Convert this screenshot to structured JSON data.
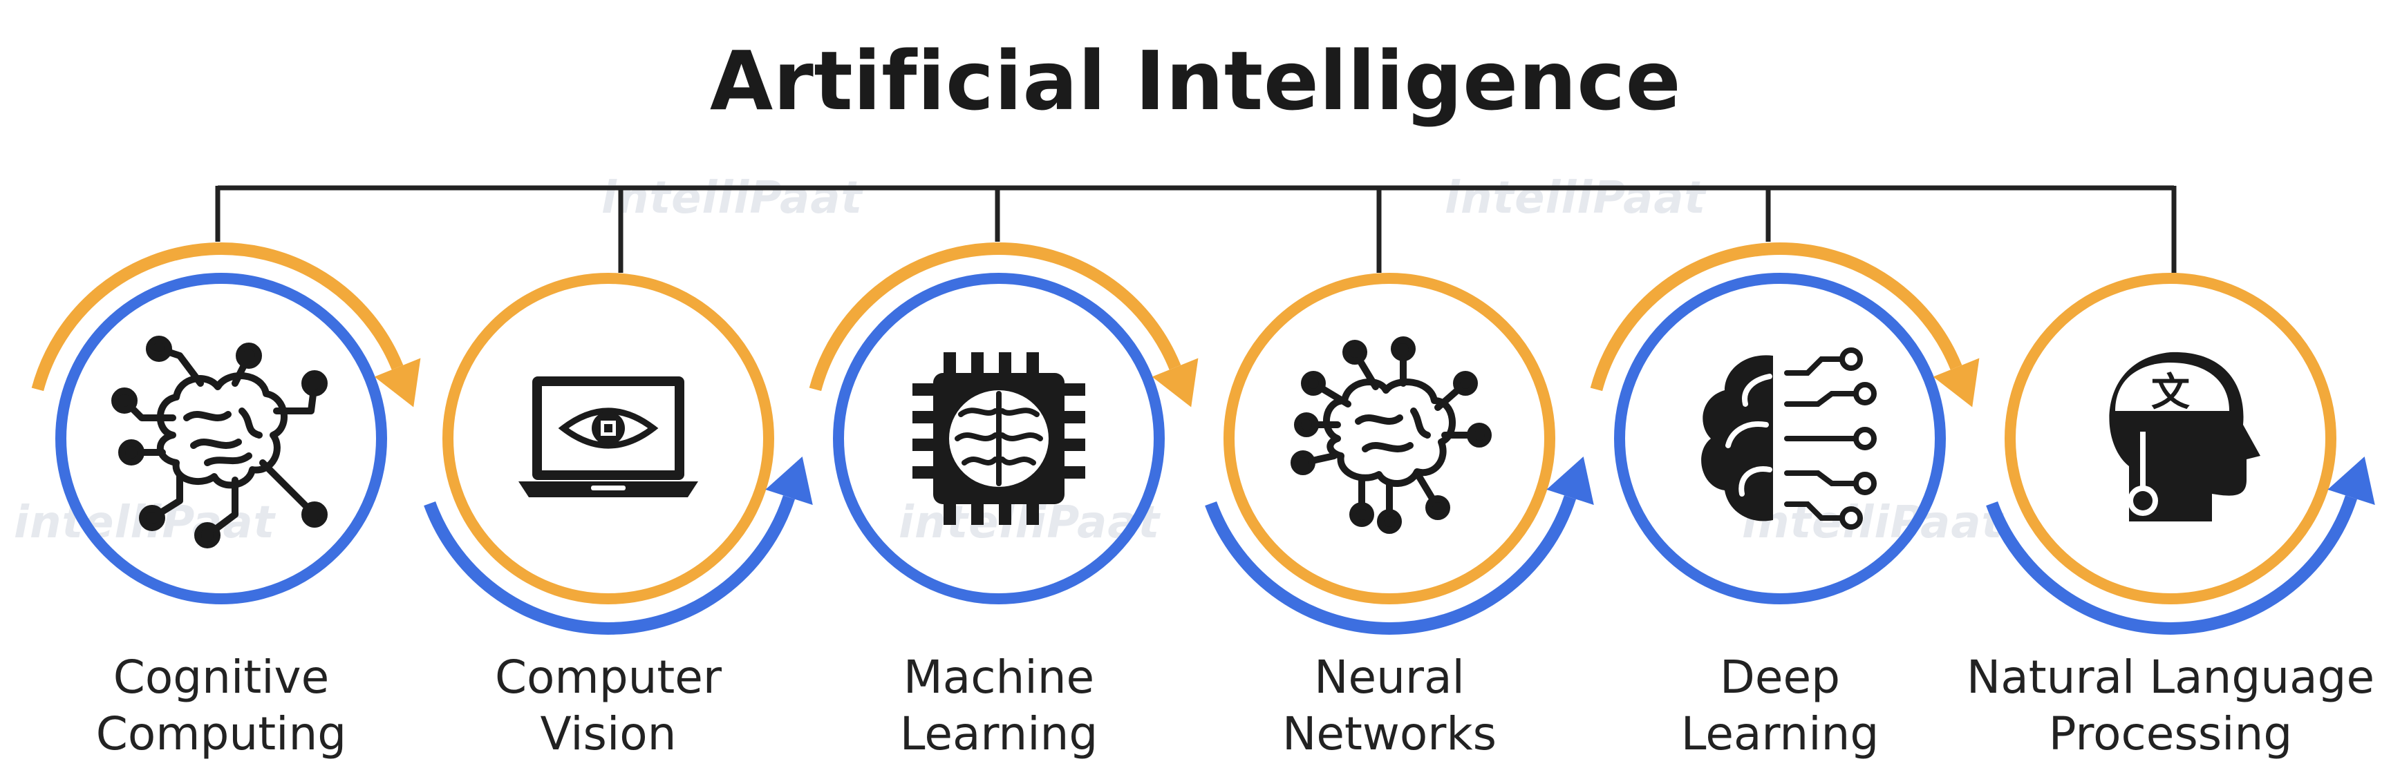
{
  "title": "Artificial Intelligence",
  "watermark": "intelliPaat",
  "colors": {
    "orange": "#F2A93B",
    "blue": "#3D6FE0",
    "line": "#222222",
    "icon": "#1b1b1b"
  },
  "nodes": [
    {
      "line1": "Cognitive",
      "line2": "Computing",
      "icon": "brain-circuit-icon",
      "inner": "blue"
    },
    {
      "line1": "Computer",
      "line2": "Vision",
      "icon": "laptop-eye-icon",
      "inner": "orange"
    },
    {
      "line1": "Machine",
      "line2": "Learning",
      "icon": "brain-chip-icon",
      "inner": "blue"
    },
    {
      "line1": "Neural",
      "line2": "Networks",
      "icon": "neural-brain-icon",
      "inner": "orange"
    },
    {
      "line1": "Deep",
      "line2": "Learning",
      "icon": "brain-nodes-icon",
      "inner": "blue"
    },
    {
      "line1": "Natural Language",
      "line2": "Processing",
      "icon": "head-language-icon",
      "inner": "orange"
    }
  ]
}
